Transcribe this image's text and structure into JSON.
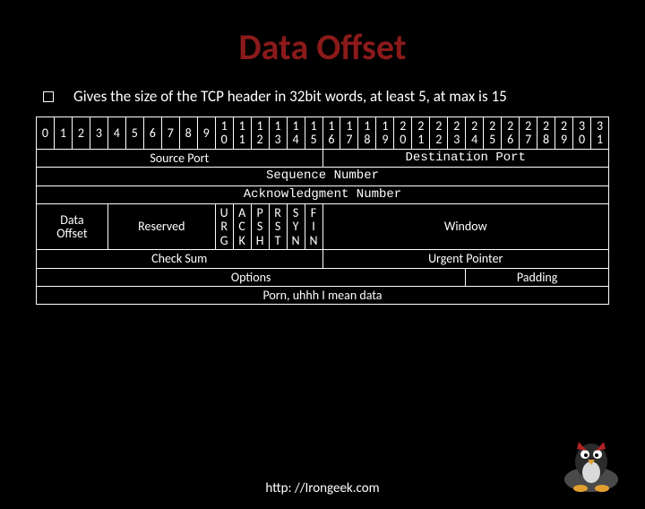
{
  "title": "Data Offset",
  "bullet": "Gives the size of the TCP header in 32bit words, at least 5, at max is 15",
  "bits": [
    "0",
    "1",
    "2",
    "3",
    "4",
    "5",
    "6",
    "7",
    "8",
    "9",
    "1\n0",
    "1\n1",
    "1\n2",
    "1\n3",
    "1\n4",
    "1\n5",
    "1\n6",
    "1\n7",
    "1\n8",
    "1\n9",
    "2\n0",
    "2\n1",
    "2\n2",
    "2\n3",
    "2\n4",
    "2\n5",
    "2\n6",
    "2\n7",
    "2\n8",
    "2\n9",
    "3\n0",
    "3\n1"
  ],
  "row2": {
    "source_port": "Source Port",
    "dest_port": "Destination Port"
  },
  "row3": {
    "seq": "Sequence Number"
  },
  "row4": {
    "ack": "Acknowledgment Number"
  },
  "row5": {
    "data_offset": "Data\nOffset",
    "reserved": "Reserved",
    "flags": [
      "U\nR\nG",
      "A\nC\nK",
      "P\nS\nH",
      "R\nS\nT",
      "S\nY\nN",
      "F\nI\nN"
    ],
    "window": "Window"
  },
  "row6": {
    "checksum": "Check Sum",
    "urgent": "Urgent Pointer"
  },
  "row7": {
    "options": "Options",
    "padding": "Padding"
  },
  "row8": {
    "data": "Porn, uhhh I mean data"
  },
  "footer": "http: //Irongeek.com"
}
